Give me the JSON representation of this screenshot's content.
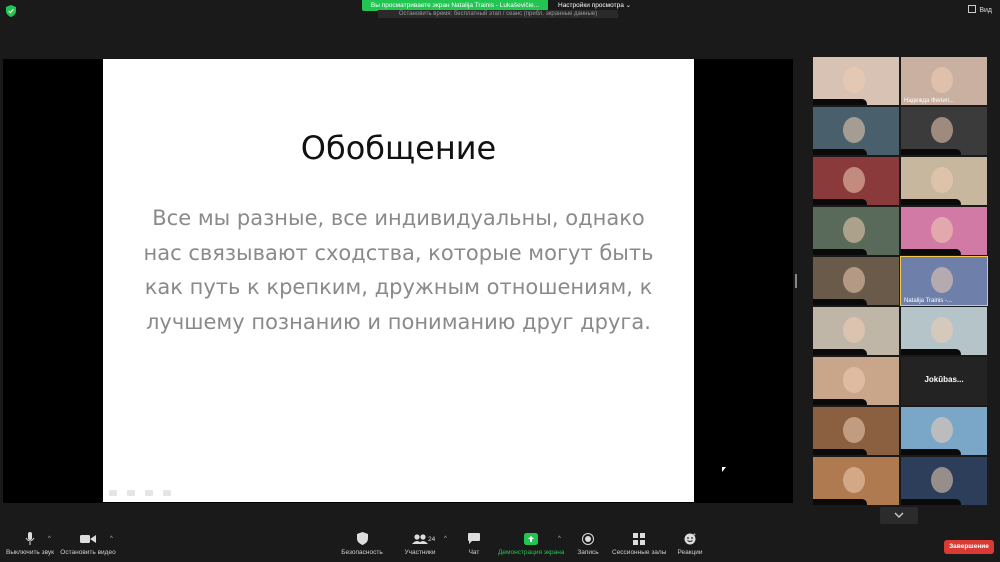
{
  "topbar": {
    "share_banner": "Вы просматриваете экран Natalija Trainis - Lukaševičie...",
    "view_options": "Настройки просмотра",
    "sub_banner": "Остановить время: бесплатный этап / сеанс (прибл. экранные данные)",
    "view_button": "Вид",
    "shield_color": "#23c552"
  },
  "slide": {
    "title": "Обобщение",
    "body": "Все мы разные, все индивидуальны, однако нас связывают сходства, которые могут быть как путь к крепким, дружным отношениям, к лучшему познанию и пониманию друг друга."
  },
  "gallery": {
    "tiles": [
      {
        "name": "",
        "bg": "#d8c2b4"
      },
      {
        "name": "Надежда Филип...",
        "bg": "#c9b0a0"
      },
      {
        "name": "",
        "bg": "#4a5f6c"
      },
      {
        "name": "",
        "bg": "#3b3b3b"
      },
      {
        "name": "",
        "bg": "#8a3a3a"
      },
      {
        "name": "",
        "bg": "#c7b79e"
      },
      {
        "name": "",
        "bg": "#5a6a5a"
      },
      {
        "name": "",
        "bg": "#d27aa6"
      },
      {
        "name": "",
        "bg": "#6a5a4a"
      },
      {
        "name": "Natalija Trainis -...",
        "bg": "#6e7faa"
      },
      {
        "name": "",
        "bg": "#c0b6a8"
      },
      {
        "name": "",
        "bg": "#b4c4c8"
      },
      {
        "name": "",
        "bg": "#c9a58a"
      },
      {
        "name": "",
        "bg": "#232323",
        "text": "Jokūbas..."
      },
      {
        "name": "",
        "bg": "#8a6040"
      },
      {
        "name": "",
        "bg": "#7aa6c8"
      },
      {
        "name": "",
        "bg": "#b07a50"
      },
      {
        "name": "",
        "bg": "#2c3e5a"
      }
    ]
  },
  "toolbar": {
    "mute": "Выключить звук",
    "video": "Остановить видео",
    "security": "Безопасность",
    "participants": "Участники",
    "participants_count": "24",
    "chat": "Чат",
    "share": "Демонстрация экрана",
    "record": "Запись",
    "breakout": "Сессионные залы",
    "reactions": "Реакции",
    "end": "Завершение",
    "share_color": "#23c552",
    "end_color": "#d93b34"
  }
}
